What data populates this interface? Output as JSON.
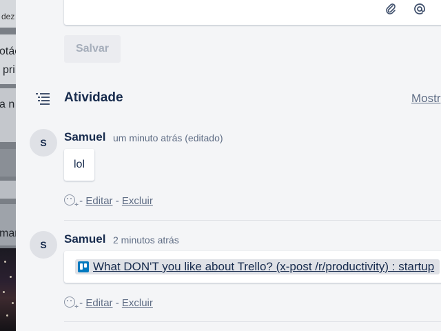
{
  "background_board": {
    "fragments": [
      "dez",
      "otác",
      "pri",
      "a n",
      "mar"
    ]
  },
  "composer": {
    "attach_icon": "paperclip-icon",
    "mention_icon": "at-sign-icon",
    "save_label": "Salvar"
  },
  "activity": {
    "title": "Atividade",
    "icon": "activity-list-icon",
    "show_details_label": "Mostr"
  },
  "comments": [
    {
      "avatar_initial": "S",
      "author": "Samuel",
      "timestamp": "um minuto atrás (editado)",
      "text": "lol",
      "edit_label": "Editar",
      "delete_label": "Excluir",
      "separator": "-"
    },
    {
      "avatar_initial": "S",
      "author": "Samuel",
      "timestamp": "2 minutos atrás",
      "link_text": "What DON'T you like about Trello? (x-post /r/productivity) : startup",
      "link_icon": "trello-icon",
      "edit_label": "Editar",
      "delete_label": "Excluir",
      "separator": "-"
    }
  ],
  "colors": {
    "modal_bg": "#f4f5f7",
    "text_primary": "#172b4d",
    "text_secondary": "#5e6c84",
    "link_chip_bg": "#dfe1e6",
    "trello_blue": "#0079bf"
  }
}
